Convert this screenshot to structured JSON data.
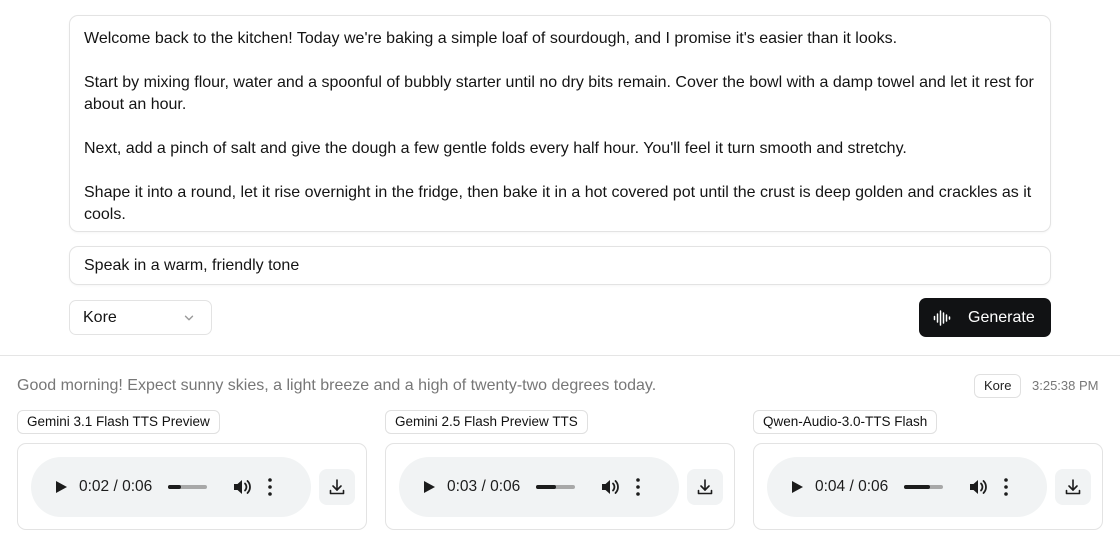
{
  "editor": {
    "script_paragraphs": [
      "Welcome back to the kitchen! Today we're baking a simple loaf of sourdough, and I promise it's easier than it looks.",
      "Start by mixing flour, water and a spoonful of bubbly starter until no dry bits remain. Cover the bowl with a damp towel and let it rest for about an hour.",
      "Next, add a pinch of salt and give the dough a few gentle folds every half hour. You'll feel it turn smooth and stretchy.",
      "Shape it into a round, let it rise overnight in the fridge, then bake it in a hot covered pot until the crust is deep golden and crackles as it cools."
    ],
    "style_instructions": "Speak in a warm, friendly tone",
    "voice_selected": "Kore",
    "generate_label": "Generate"
  },
  "result": {
    "text": "Good morning! Expect sunny skies, a light breeze and a high of twenty-two degrees today.",
    "voice_badge": "Kore",
    "time": "3:25:38 PM",
    "outputs": [
      {
        "model": "Gemini 3.1 Flash TTS Preview",
        "time_display": "0:02 / 0:06",
        "progress": 0.333
      },
      {
        "model": "Gemini 2.5 Flash Preview TTS",
        "time_display": "0:03 / 0:06",
        "progress": 0.5
      },
      {
        "model": "Qwen-Audio-3.0-TTS Flash",
        "time_display": "0:04 / 0:06",
        "progress": 0.667
      }
    ]
  },
  "icons": {
    "voice_dropdown": "chevron-down-icon",
    "generate": "audio-waveform-icon",
    "play": "play-icon",
    "volume": "volume-icon",
    "more": "more-vertical-icon",
    "download": "download-icon"
  },
  "colors": {
    "generate_bg": "#111214",
    "player_bg": "#f1f3f4",
    "muted_text": "#777777",
    "border": "#e3e3e3"
  }
}
